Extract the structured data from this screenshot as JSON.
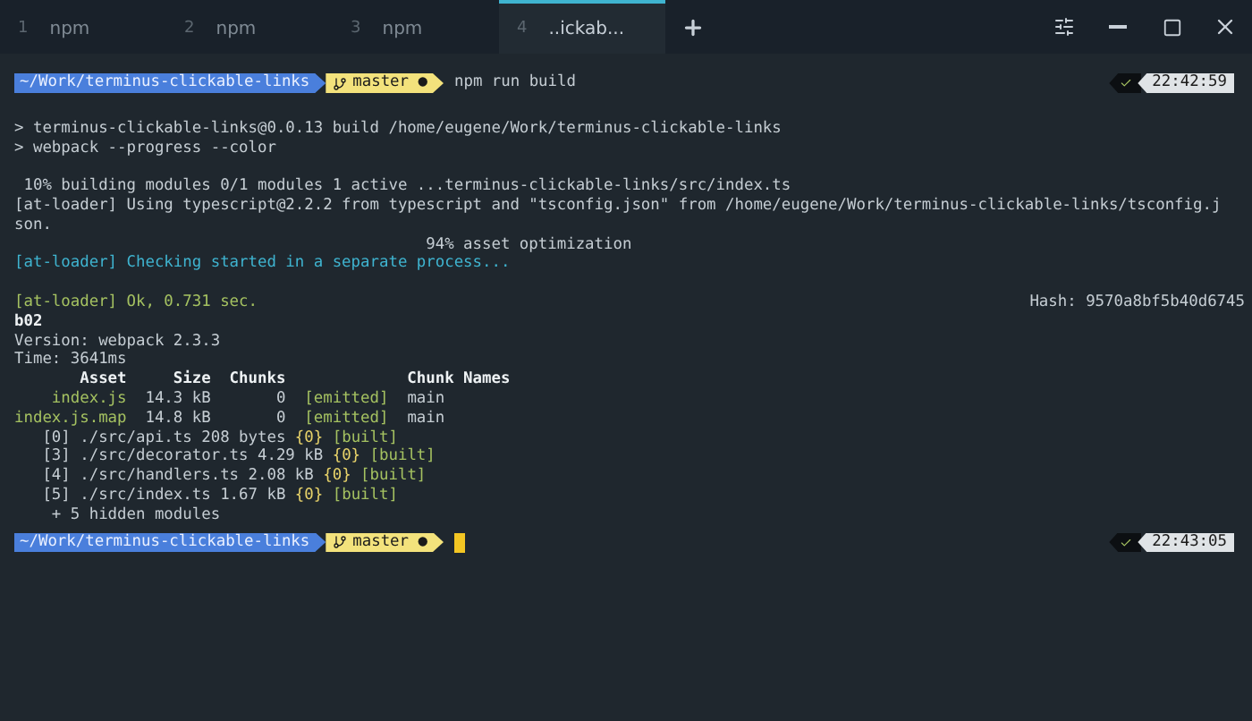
{
  "tabs": [
    {
      "number": "1",
      "title": "npm",
      "selected": false
    },
    {
      "number": "2",
      "title": "npm",
      "selected": false
    },
    {
      "number": "3",
      "title": "npm",
      "selected": false
    },
    {
      "number": "4",
      "title": "..ickab...",
      "selected": true
    }
  ],
  "lines": [
    {
      "kind": "prompt",
      "path": "~/Work/terminus-clickable-links",
      "branch": "master ●",
      "command": "npm run build",
      "time": "22:42:59"
    },
    {
      "kind": "blank"
    },
    {
      "kind": "output",
      "segments": [
        {
          "text": "> terminus-clickable-links@0.0.13 build /home/eugene/Work/terminus-clickable-links",
          "kind": "plain"
        }
      ]
    },
    {
      "kind": "output",
      "segments": [
        {
          "text": "> webpack --progress --color",
          "kind": "plain"
        }
      ]
    },
    {
      "kind": "blank"
    },
    {
      "kind": "output",
      "segments": [
        {
          "text": " 10% building modules 0/1 modules 1 active ...terminus-clickable-links/src/index.ts",
          "kind": "plain"
        }
      ]
    },
    {
      "kind": "output",
      "segments": [
        {
          "text": "[at-loader] Using typescript@2.2.2 from typescript and \"tsconfig.json\" from /home/eugene/Work/terminus-clickable-links/tsconfig.j",
          "kind": "plain"
        }
      ]
    },
    {
      "kind": "output",
      "segments": [
        {
          "text": "son.",
          "kind": "plain"
        }
      ]
    },
    {
      "kind": "output",
      "segments": [
        {
          "text": "                                            94% asset optimization",
          "kind": "plain"
        }
      ]
    },
    {
      "kind": "output",
      "segments": [
        {
          "text": "[at-loader] Checking started in a separate process...",
          "kind": "cyan"
        }
      ]
    },
    {
      "kind": "blank"
    },
    {
      "kind": "output",
      "segments": [
        {
          "text": "[at-loader] Ok, 0.731 sec.",
          "kind": "green"
        }
      ],
      "right": "Hash: 9570a8bf5b40d6745"
    },
    {
      "kind": "output",
      "segments": [
        {
          "text": "b02",
          "kind": "bold"
        }
      ]
    },
    {
      "kind": "output",
      "segments": [
        {
          "text": "Version: webpack 2.3.3",
          "kind": "plain"
        }
      ]
    },
    {
      "kind": "output",
      "segments": [
        {
          "text": "Time: 3641ms",
          "kind": "plain"
        }
      ]
    },
    {
      "kind": "output",
      "segments": [
        {
          "text": "       Asset     Size  Chunks             Chunk Names",
          "kind": "bold"
        }
      ]
    },
    {
      "kind": "output",
      "segments": [
        {
          "text": "    index.js",
          "kind": "green"
        },
        {
          "text": "  14.3 kB       0  ",
          "kind": "plain"
        },
        {
          "text": "[emitted]",
          "kind": "green"
        },
        {
          "text": "  main",
          "kind": "plain"
        }
      ]
    },
    {
      "kind": "output",
      "segments": [
        {
          "text": "index.js.map",
          "kind": "green"
        },
        {
          "text": "  14.8 kB       0  ",
          "kind": "plain"
        },
        {
          "text": "[emitted]",
          "kind": "green"
        },
        {
          "text": "  main",
          "kind": "plain"
        }
      ]
    },
    {
      "kind": "output",
      "segments": [
        {
          "text": "   [0] ./src/api.ts 208 bytes ",
          "kind": "plain"
        },
        {
          "text": "{0}",
          "kind": "yellow"
        },
        {
          "text": " [built]",
          "kind": "green"
        }
      ]
    },
    {
      "kind": "output",
      "segments": [
        {
          "text": "   [3] ./src/decorator.ts 4.29 kB ",
          "kind": "plain"
        },
        {
          "text": "{0}",
          "kind": "yellow"
        },
        {
          "text": " [built]",
          "kind": "green"
        }
      ]
    },
    {
      "kind": "output",
      "segments": [
        {
          "text": "   [4] ./src/handlers.ts 2.08 kB ",
          "kind": "plain"
        },
        {
          "text": "{0}",
          "kind": "yellow"
        },
        {
          "text": " [built]",
          "kind": "green"
        }
      ]
    },
    {
      "kind": "output",
      "segments": [
        {
          "text": "   [5] ./src/index.ts 1.67 kB ",
          "kind": "plain"
        },
        {
          "text": "{0}",
          "kind": "yellow"
        },
        {
          "text": " [built]",
          "kind": "green"
        }
      ]
    },
    {
      "kind": "output",
      "segments": [
        {
          "text": "    + 5 hidden modules",
          "kind": "plain"
        }
      ]
    },
    {
      "kind": "prompt",
      "path": "~/Work/terminus-clickable-links",
      "branch": "master ●",
      "time": "22:43:05",
      "cursor": true
    }
  ]
}
